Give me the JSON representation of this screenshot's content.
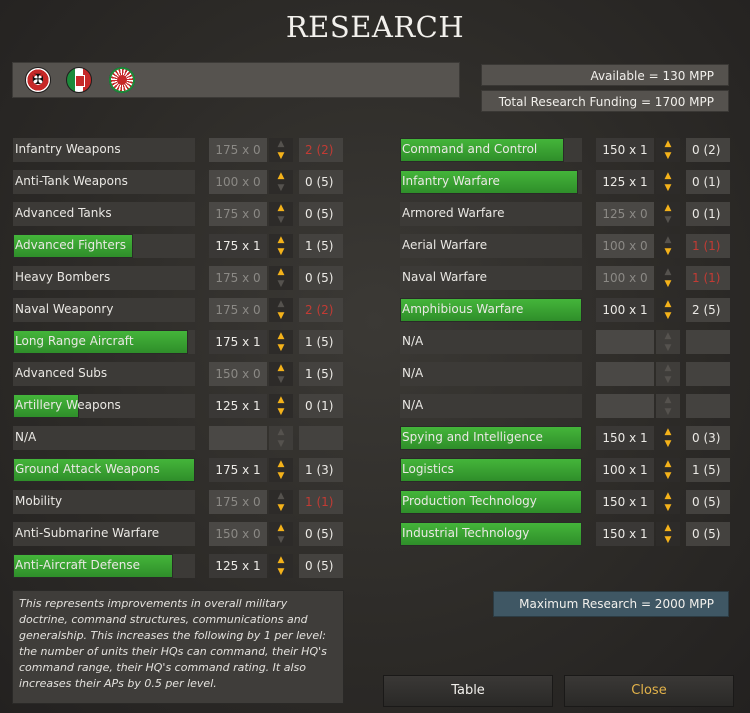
{
  "title": "RESEARCH",
  "available": "Available = 130 MPP",
  "funding": "Total Research Funding = 1700 MPP",
  "max_research": "Maximum Research = 2000 MPP",
  "description": "This represents improvements in overall military doctrine, command structures, communications and generalship. This increases the following by 1 per level: the number of units their HQs can command, their HQ's command range, their HQ's command rating. It also increases their APs by 0.5 per level.",
  "buttons": {
    "table": "Table",
    "close": "Close"
  },
  "flags": [
    "germany-flag-icon",
    "italy-flag-icon",
    "japan-flag-icon"
  ],
  "colors": {
    "progress_green": "#3fae36",
    "arrow_active": "#f4b21a",
    "level_red": "#c23b34",
    "close_text": "#e2b24a"
  },
  "left_rows": [
    {
      "name": "Infantry Weapons",
      "cost": "175 x 0",
      "level": "2 (2)",
      "progress": 0,
      "active": false,
      "red": true
    },
    {
      "name": "Anti-Tank Weapons",
      "cost": "100 x 0",
      "level": "0 (5)",
      "progress": 0,
      "active": false,
      "arrows": true
    },
    {
      "name": "Advanced Tanks",
      "cost": "175 x 0",
      "level": "0 (5)",
      "progress": 0,
      "active": false,
      "arrows": true
    },
    {
      "name": "Advanced Fighters",
      "cost": "175 x 1",
      "level": "1 (5)",
      "progress": 0.66,
      "active": true
    },
    {
      "name": "Heavy Bombers",
      "cost": "175 x 0",
      "level": "0 (5)",
      "progress": 0,
      "active": false,
      "arrows": true
    },
    {
      "name": "Naval Weaponry",
      "cost": "175 x 0",
      "level": "2 (2)",
      "progress": 0,
      "active": false,
      "red": true
    },
    {
      "name": "Long Range Aircraft",
      "cost": "175 x 1",
      "level": "1 (5)",
      "progress": 0.96,
      "active": true
    },
    {
      "name": "Advanced Subs",
      "cost": "150 x 0",
      "level": "1 (5)",
      "progress": 0,
      "active": false,
      "arrows": true
    },
    {
      "name": "Artillery Weapons",
      "cost": "125 x 1",
      "level": "0 (1)",
      "progress": 0.36,
      "active": true
    },
    {
      "name": "N/A",
      "cost": "",
      "level": "",
      "progress": 0,
      "active": false,
      "empty": true
    },
    {
      "name": "Ground Attack Weapons",
      "cost": "175 x 1",
      "level": "1 (3)",
      "progress": 1,
      "active": true
    },
    {
      "name": "Mobility",
      "cost": "175 x 0",
      "level": "1 (1)",
      "progress": 0,
      "active": false,
      "red": true
    },
    {
      "name": "Anti-Submarine Warfare",
      "cost": "150 x 0",
      "level": "0 (5)",
      "progress": 0,
      "active": false,
      "arrows": true
    },
    {
      "name": "Anti-Aircraft Defense",
      "cost": "125 x 1",
      "level": "0 (5)",
      "progress": 0.88,
      "active": true
    }
  ],
  "right_rows": [
    {
      "name": "Command and Control",
      "cost": "150 x 1",
      "level": "0 (2)",
      "progress": 0.9,
      "active": true
    },
    {
      "name": "Infantry Warfare",
      "cost": "125 x 1",
      "level": "0 (1)",
      "progress": 0.98,
      "active": true
    },
    {
      "name": "Armored Warfare",
      "cost": "125 x 0",
      "level": "0 (1)",
      "progress": 0,
      "active": false,
      "arrows": true
    },
    {
      "name": "Aerial Warfare",
      "cost": "100 x 0",
      "level": "1 (1)",
      "progress": 0,
      "active": false,
      "red": true
    },
    {
      "name": "Naval Warfare",
      "cost": "100 x 0",
      "level": "1 (1)",
      "progress": 0,
      "active": false,
      "red": true
    },
    {
      "name": "Amphibious Warfare",
      "cost": "100 x 1",
      "level": "2 (5)",
      "progress": 1,
      "active": true
    },
    {
      "name": "N/A",
      "cost": "",
      "level": "",
      "progress": 0,
      "active": false,
      "empty": true
    },
    {
      "name": "N/A",
      "cost": "",
      "level": "",
      "progress": 0,
      "active": false,
      "empty": true
    },
    {
      "name": "N/A",
      "cost": "",
      "level": "",
      "progress": 0,
      "active": false,
      "empty": true
    },
    {
      "name": "Spying and Intelligence",
      "cost": "150 x 1",
      "level": "0 (3)",
      "progress": 1,
      "active": true
    },
    {
      "name": "Logistics",
      "cost": "100 x 1",
      "level": "1 (5)",
      "progress": 1,
      "active": true
    },
    {
      "name": "Production Technology",
      "cost": "150 x 1",
      "level": "0 (5)",
      "progress": 1,
      "active": true
    },
    {
      "name": "Industrial Technology",
      "cost": "150 x 1",
      "level": "0 (5)",
      "progress": 1,
      "active": true
    }
  ]
}
